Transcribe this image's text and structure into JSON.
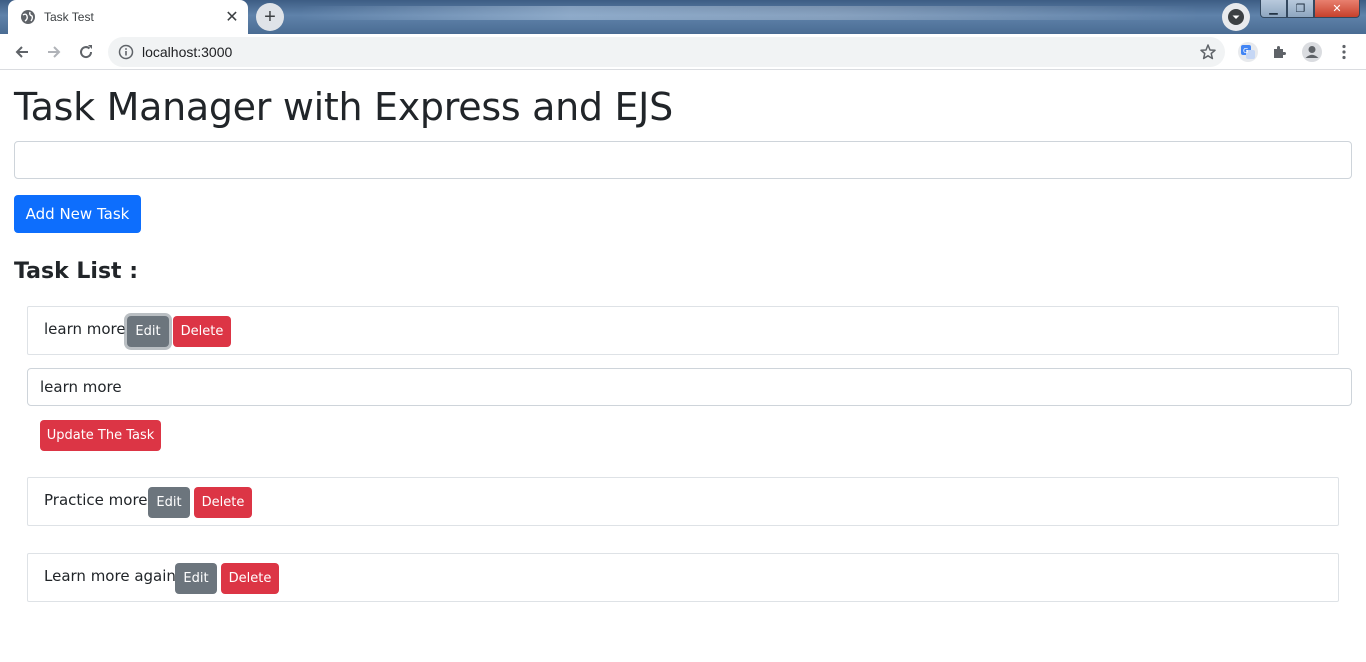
{
  "browser": {
    "tab_title": "Task Test",
    "tab_close": "✕",
    "new_tab": "+",
    "url": "localhost:3000",
    "window_controls": {
      "minimize": "▁",
      "restore": "❐",
      "close": "✕"
    }
  },
  "app": {
    "title": "Task Manager with Express and EJS",
    "new_task_input": {
      "value": "",
      "placeholder": ""
    },
    "add_button_label": "Add New Task",
    "list_heading": "Task List :"
  },
  "tasks": [
    {
      "text": "learn more",
      "edit_label": "Edit",
      "delete_label": "Delete"
    },
    {
      "text": "Practice more",
      "edit_label": "Edit",
      "delete_label": "Delete"
    },
    {
      "text": "Learn more again",
      "edit_label": "Edit",
      "delete_label": "Delete"
    }
  ],
  "edit_form": {
    "input_value": "learn more",
    "update_label": "Update The Task"
  },
  "colors": {
    "primary": "#0d6efd",
    "secondary": "#6c757d",
    "danger": "#dc3545",
    "text": "#212529",
    "border": "#dee2e6"
  },
  "icons": [
    "globe-icon",
    "close-icon",
    "plus-icon",
    "back-icon",
    "forward-icon",
    "reload-icon",
    "info-icon",
    "star-icon",
    "translate-icon",
    "puzzle-icon",
    "account-icon",
    "kebab-menu-icon"
  ]
}
